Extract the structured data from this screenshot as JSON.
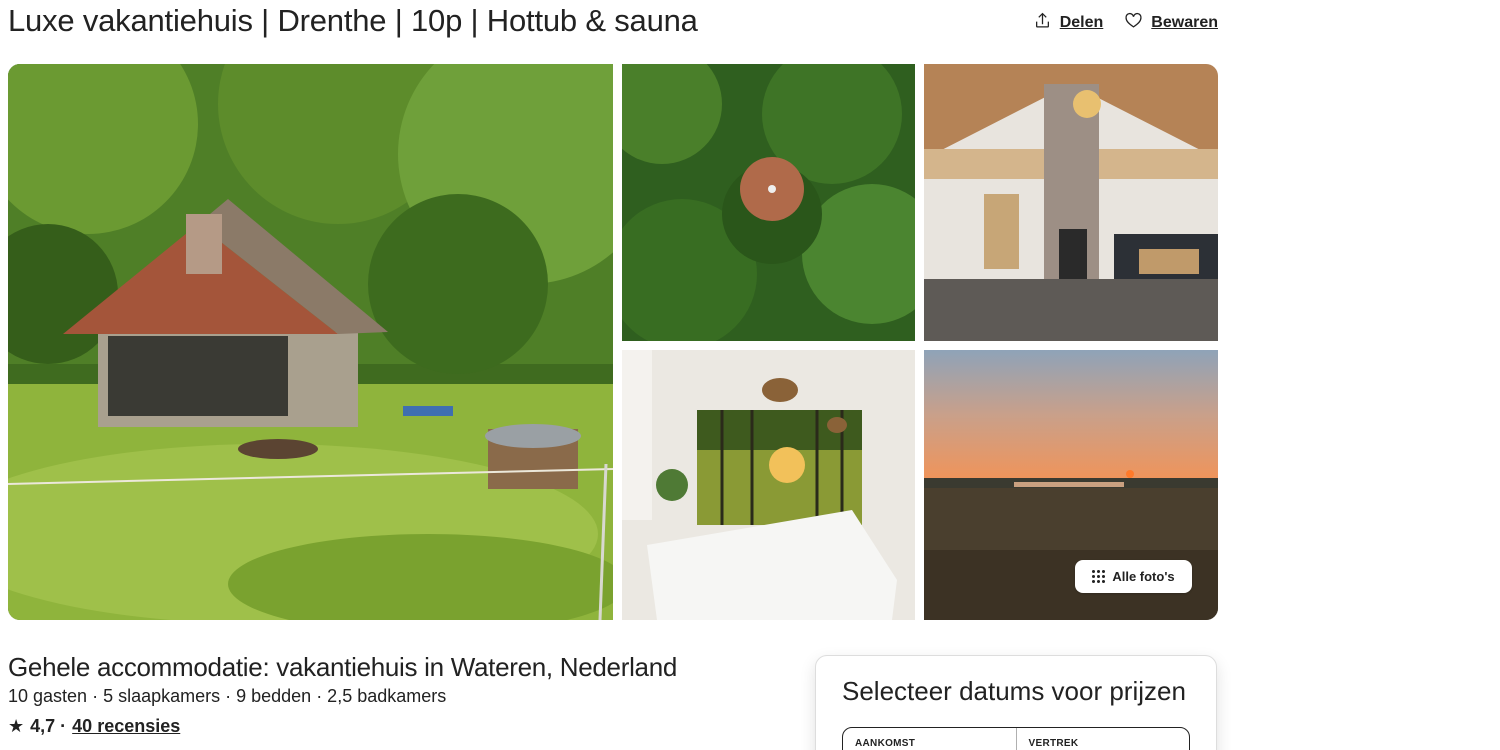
{
  "listing": {
    "title": "Luxe vakantiehuis | Drenthe | 10p | Hottub & sauna",
    "share_label": "Delen",
    "save_label": "Bewaren"
  },
  "gallery": {
    "all_photos_label": "Alle foto's"
  },
  "overview": {
    "subtitle": "Gehele accommodatie: vakantiehuis in Wateren, Nederland",
    "details": "10 gasten · 5 slaapkamers · 9 bedden · 2,5 badkamers",
    "rating_star": "★",
    "rating_value": "4,7 ·",
    "reviews_label": "40 recensies"
  },
  "booking": {
    "title": "Selecteer datums voor prijzen",
    "checkin_label": "AANKOMST",
    "checkout_label": "VERTREK"
  },
  "colors": {
    "text": "#222222",
    "border": "#dddddd"
  }
}
